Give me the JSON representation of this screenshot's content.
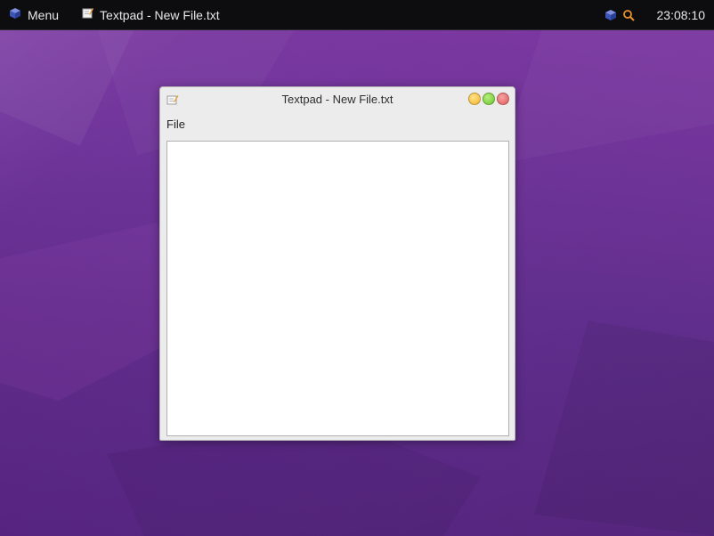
{
  "panel": {
    "menu_label": "Menu",
    "task_label": "Textpad - New File.txt",
    "clock": "23:08:10"
  },
  "icons": {
    "menu": "cube-icon",
    "task": "textpad-icon",
    "tray_network": "cube-icon",
    "tray_search": "magnifier-icon"
  },
  "window": {
    "title": "Textpad - New File.txt",
    "menu": [
      "File"
    ],
    "editor_text": ""
  },
  "colors": {
    "panel_bg": "#0d0d10",
    "desktop": "#6a3294",
    "minimize": "#f2b52a",
    "maximize": "#6cc431",
    "close": "#e05a5a",
    "search_accent": "#e8912b"
  }
}
